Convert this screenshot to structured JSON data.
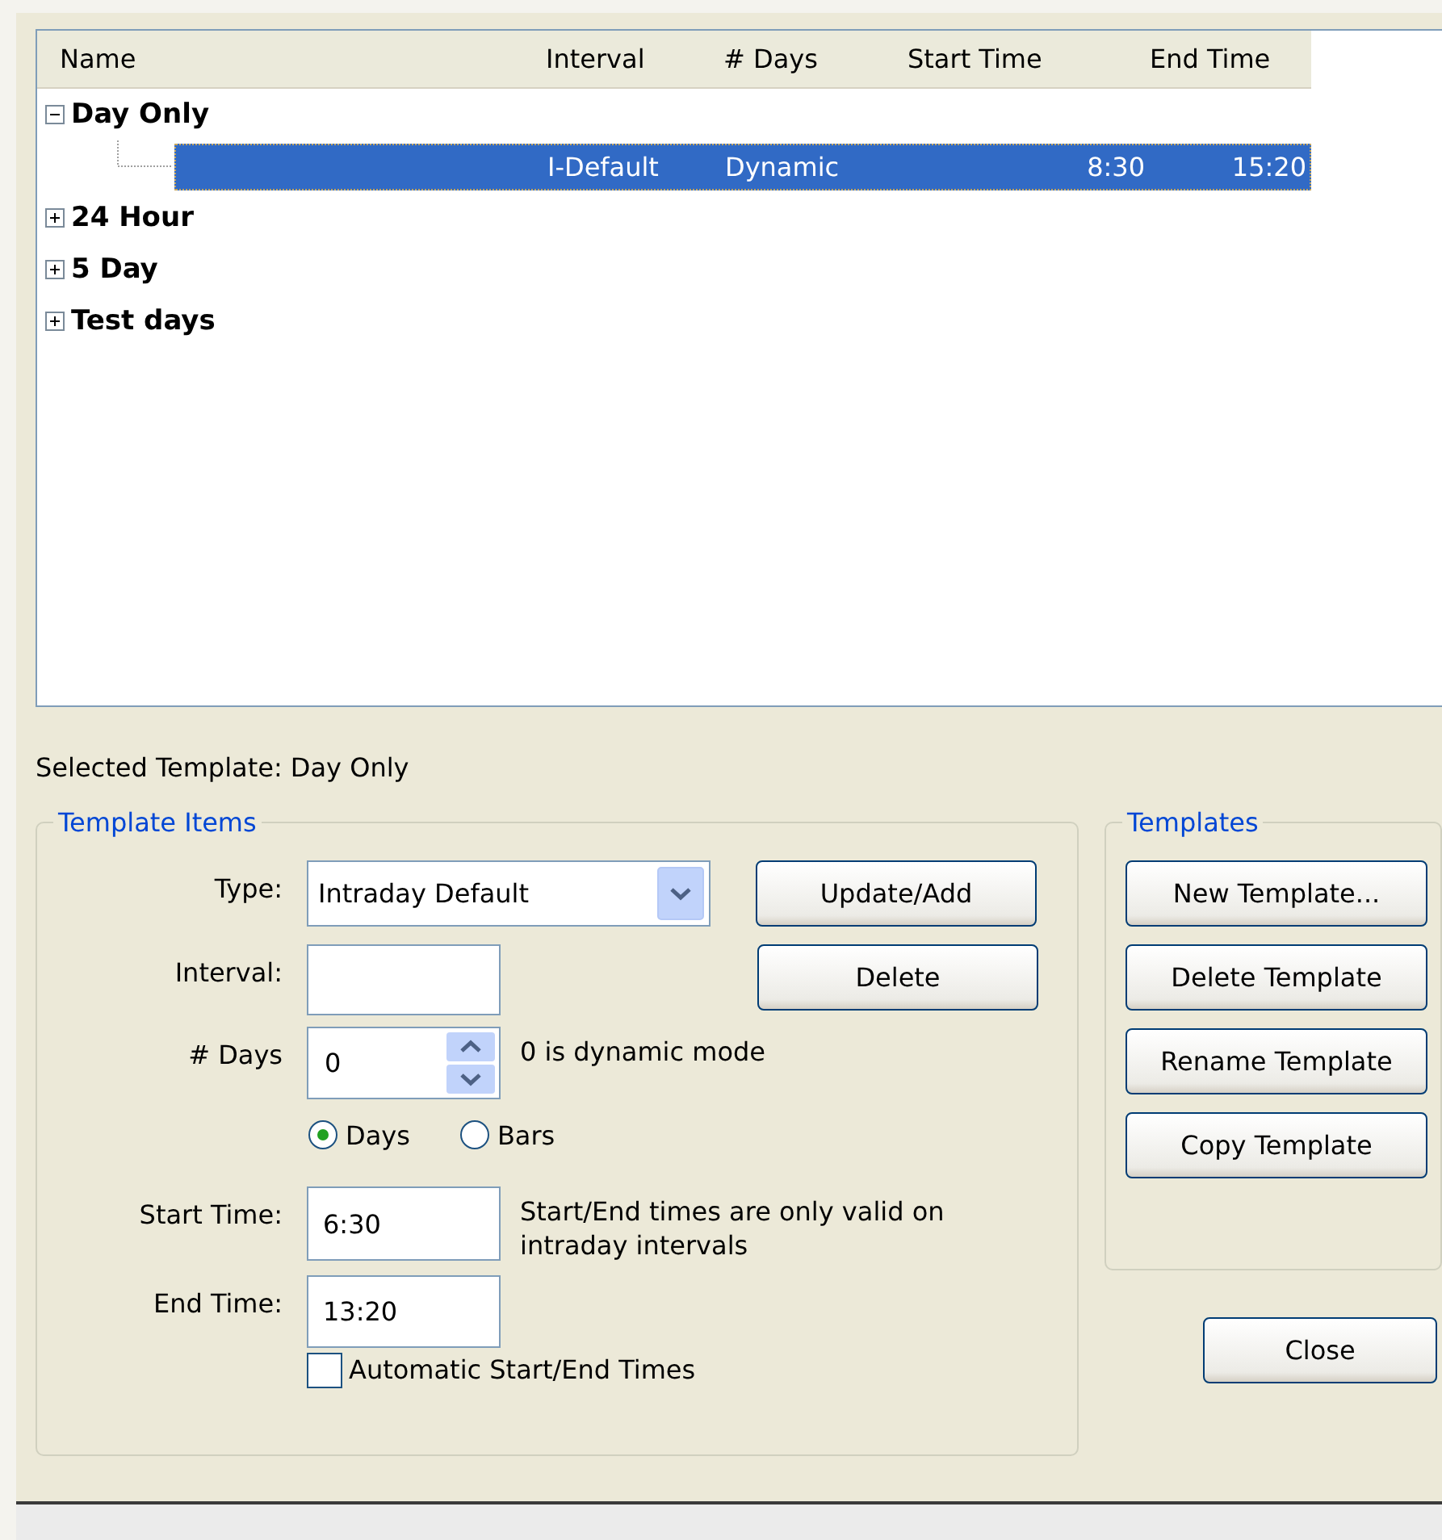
{
  "tree": {
    "columns": [
      "Name",
      "Interval",
      "# Days",
      "Start Time",
      "End Time"
    ],
    "nodes": [
      {
        "name": "Day Only",
        "expanded": true,
        "children": [
          {
            "cells": [
              "I-Default",
              "Dynamic",
              "8:30",
              "15:20"
            ],
            "selected": true
          }
        ]
      },
      {
        "name": "24 Hour",
        "expanded": false
      },
      {
        "name": "5 Day",
        "expanded": false
      },
      {
        "name": "Test days",
        "expanded": false
      }
    ]
  },
  "selected_template": "Selected Template: Day Only",
  "template_items": {
    "title": "Template Items",
    "type": {
      "label": "Type:",
      "value": "Intraday Default"
    },
    "interval": {
      "label": "Interval:"
    },
    "days": {
      "label": "# Days",
      "value": "0",
      "note": "0 is dynamic mode"
    },
    "units": [
      {
        "label": "Days",
        "selected": true
      },
      {
        "label": "Bars",
        "selected": false
      }
    ],
    "start_time": {
      "label": "Start Time:",
      "value": "6:30"
    },
    "end_time": {
      "label": "End Time:",
      "value": "13:20"
    },
    "time_note": "Start/End times are only valid on intraday intervals",
    "auto_times": {
      "label": "Automatic Start/End Times",
      "checked": false
    },
    "buttons": [
      "Update/Add",
      "Delete"
    ]
  },
  "templates": {
    "title": "Templates",
    "buttons": [
      "New Template...",
      "Delete Template",
      "Rename Template",
      "Copy Template"
    ]
  },
  "close_button": "Close"
}
